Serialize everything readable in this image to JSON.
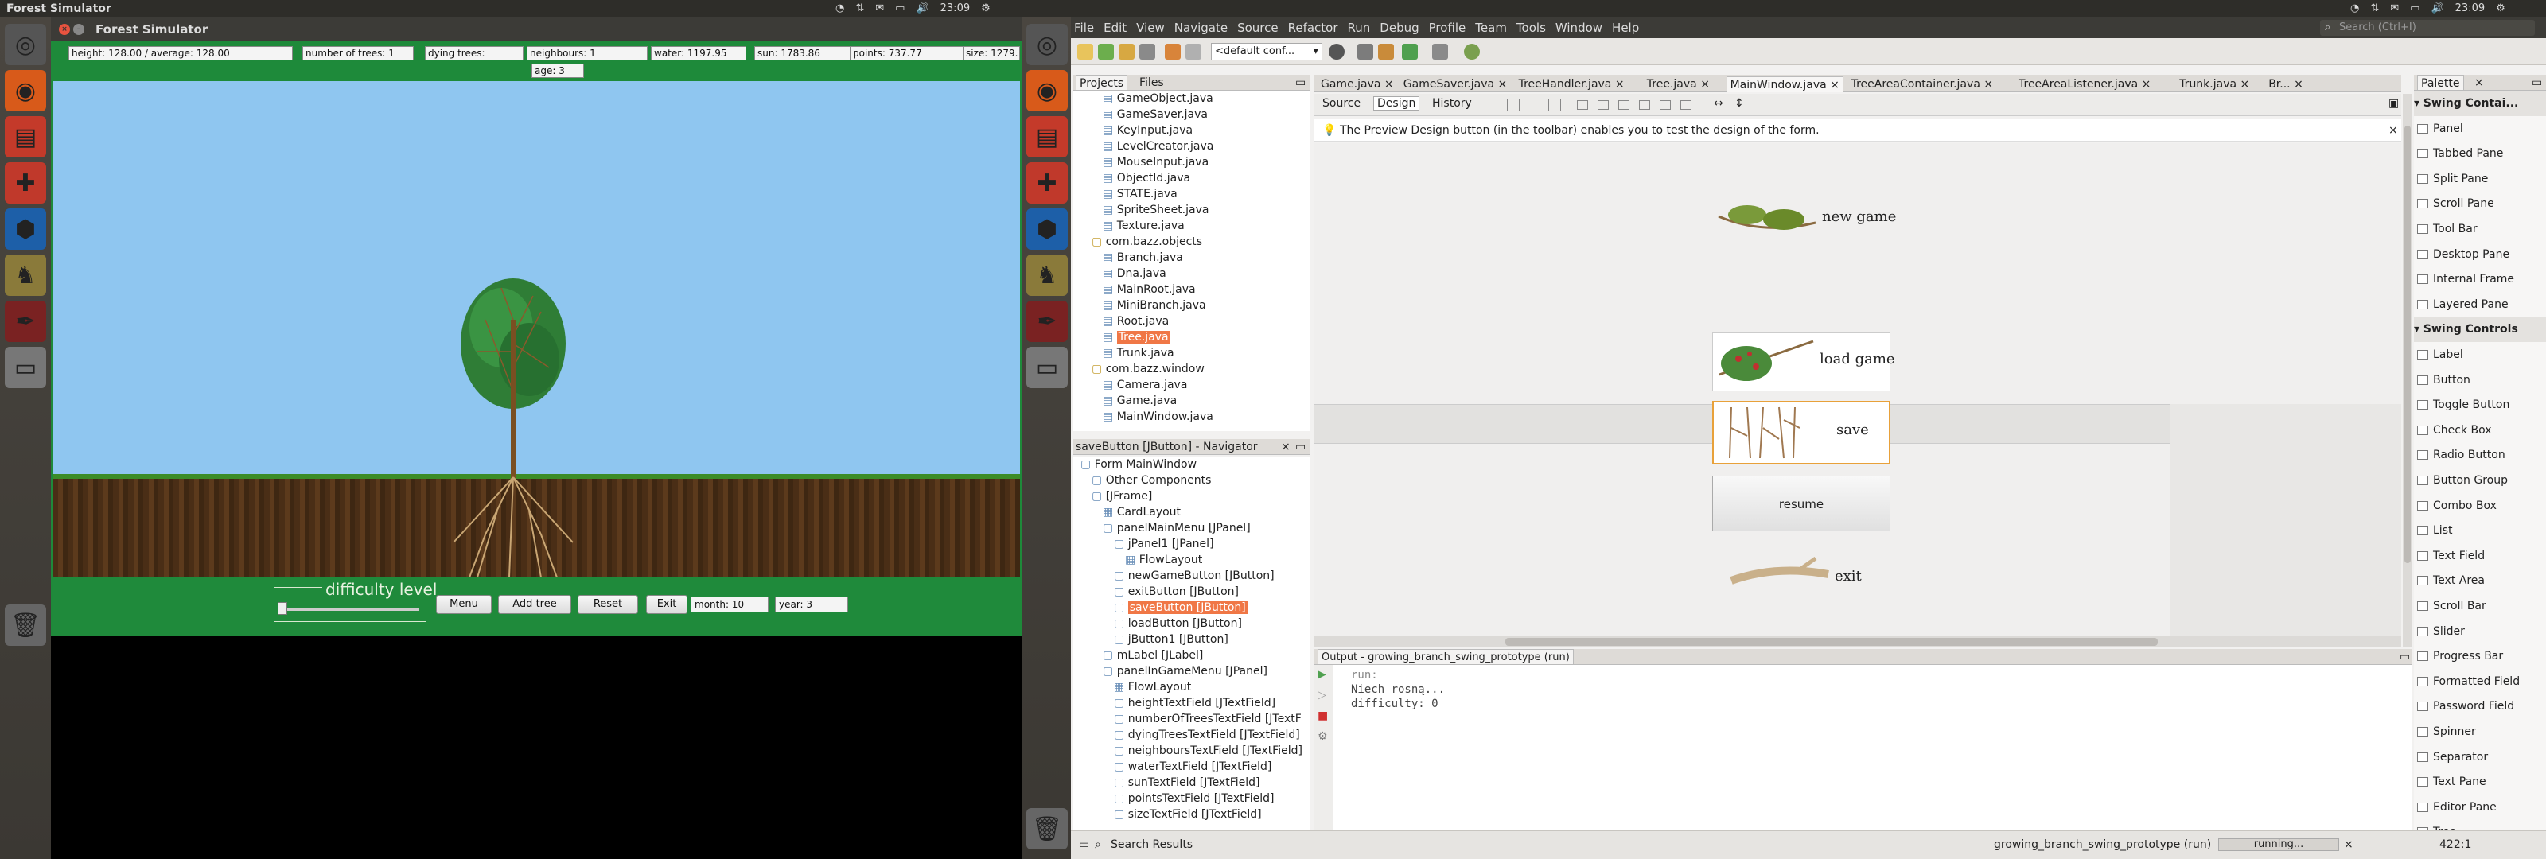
{
  "left_topbar": {
    "title": "Forest Simulator",
    "time": "23:09"
  },
  "right_topbar": {
    "time": "23:09"
  },
  "forest": {
    "window_title": "Forest Simulator",
    "stats": {
      "height": "height: 128.00 / average: 128.00",
      "trees": "number of trees: 1",
      "dying": "dying trees:",
      "neighbours": "neighbours: 1",
      "water": "water: 1197.95",
      "sun": "sun: 1783.86",
      "points": "points: 737.77",
      "size": "size: 1279.",
      "age": "age: 3"
    },
    "difficulty_label": "difficulty level",
    "difficulty_value": 0.0,
    "buttons": {
      "menu": "Menu",
      "add_tree": "Add tree",
      "reset": "Reset",
      "exit": "Exit"
    },
    "month": "month: 10",
    "year": "year: 3"
  },
  "ide": {
    "menu": [
      "File",
      "Edit",
      "View",
      "Navigate",
      "Source",
      "Refactor",
      "Run",
      "Debug",
      "Profile",
      "Team",
      "Tools",
      "Window",
      "Help"
    ],
    "search_placeholder": "Search (Ctrl+I)",
    "config": "<default conf...",
    "projects_tab": "Projects",
    "files_tab": "Files",
    "project_items": [
      {
        "label": "GameObject.java",
        "indent": 2
      },
      {
        "label": "GameSaver.java",
        "indent": 2
      },
      {
        "label": "KeyInput.java",
        "indent": 2
      },
      {
        "label": "LevelCreator.java",
        "indent": 2
      },
      {
        "label": "MouseInput.java",
        "indent": 2
      },
      {
        "label": "ObjectId.java",
        "indent": 2
      },
      {
        "label": "STATE.java",
        "indent": 2
      },
      {
        "label": "SpriteSheet.java",
        "indent": 2
      },
      {
        "label": "Texture.java",
        "indent": 2
      },
      {
        "label": "com.bazz.objects",
        "indent": 1
      },
      {
        "label": "Branch.java",
        "indent": 2
      },
      {
        "label": "Dna.java",
        "indent": 2
      },
      {
        "label": "MainRoot.java",
        "indent": 2
      },
      {
        "label": "MiniBranch.java",
        "indent": 2
      },
      {
        "label": "Root.java",
        "indent": 2
      },
      {
        "label": "Tree.java",
        "indent": 2,
        "selected": true
      },
      {
        "label": "Trunk.java",
        "indent": 2
      },
      {
        "label": "com.bazz.window",
        "indent": 1
      },
      {
        "label": "Camera.java",
        "indent": 2
      },
      {
        "label": "Game.java",
        "indent": 2
      },
      {
        "label": "MainWindow.java",
        "indent": 2
      }
    ],
    "navigator_title": "saveButton [JButton] - Navigator",
    "navigator_items": [
      {
        "label": "Form MainWindow",
        "indent": 0
      },
      {
        "label": "Other Components",
        "indent": 1
      },
      {
        "label": "[JFrame]",
        "indent": 1
      },
      {
        "label": "CardLayout",
        "indent": 2
      },
      {
        "label": "panelMainMenu [JPanel]",
        "indent": 2
      },
      {
        "label": "jPanel1 [JPanel]",
        "indent": 3
      },
      {
        "label": "FlowLayout",
        "indent": 4
      },
      {
        "label": "newGameButton [JButton]",
        "indent": 3
      },
      {
        "label": "exitButton [JButton]",
        "indent": 3
      },
      {
        "label": "saveButton [JButton]",
        "indent": 3,
        "selected": true
      },
      {
        "label": "loadButton [JButton]",
        "indent": 3
      },
      {
        "label": "jButton1 [JButton]",
        "indent": 3
      },
      {
        "label": "mLabel [JLabel]",
        "indent": 2
      },
      {
        "label": "panelInGameMenu [JPanel]",
        "indent": 2
      },
      {
        "label": "FlowLayout",
        "indent": 3
      },
      {
        "label": "heightTextField [JTextField]",
        "indent": 3
      },
      {
        "label": "numberOfTreesTextField [JTextF",
        "indent": 3
      },
      {
        "label": "dyingTreesTextField [JTextField]",
        "indent": 3
      },
      {
        "label": "neighboursTextField [JTextField]",
        "indent": 3
      },
      {
        "label": "waterTextField [JTextField]",
        "indent": 3
      },
      {
        "label": "sunTextField [JTextField]",
        "indent": 3
      },
      {
        "label": "pointsTextField [JTextField]",
        "indent": 3
      },
      {
        "label": "sizeTextField [JTextField]",
        "indent": 3
      }
    ],
    "editor_tabs": [
      "Game.java",
      "GameSaver.java",
      "TreeHandler.java",
      "Tree.java",
      "MainWindow.java",
      "TreeAreaContainer.java",
      "TreeAreaListener.java",
      "Trunk.java",
      "Br..."
    ],
    "active_tab": "MainWindow.java",
    "view_tabs": {
      "source": "Source",
      "design": "Design",
      "history": "History"
    },
    "info_text": "The Preview Design button (in the toolbar) enables you to test the design of the form.",
    "form_buttons": {
      "new_game": "new game",
      "load_game": "load game",
      "save": "save",
      "resume": "resume",
      "exit": "exit"
    },
    "output_title": "Output - growing_branch_swing_prototype (run)",
    "output_lines": [
      "run:",
      "Niech rosną...",
      "difficulty: 0"
    ],
    "palette_title": "Palette",
    "palette_items": [
      {
        "label": "Swing Contai...",
        "header": true
      },
      {
        "label": "Panel"
      },
      {
        "label": "Tabbed Pane"
      },
      {
        "label": "Split Pane"
      },
      {
        "label": "Scroll Pane"
      },
      {
        "label": "Tool Bar"
      },
      {
        "label": "Desktop Pane"
      },
      {
        "label": "Internal Frame"
      },
      {
        "label": "Layered Pane"
      },
      {
        "label": "Swing Controls",
        "header": true
      },
      {
        "label": "Label"
      },
      {
        "label": "Button"
      },
      {
        "label": "Toggle Button"
      },
      {
        "label": "Check Box"
      },
      {
        "label": "Radio Button"
      },
      {
        "label": "Button Group"
      },
      {
        "label": "Combo Box"
      },
      {
        "label": "List"
      },
      {
        "label": "Text Field"
      },
      {
        "label": "Text Area"
      },
      {
        "label": "Scroll Bar"
      },
      {
        "label": "Slider"
      },
      {
        "label": "Progress Bar"
      },
      {
        "label": "Formatted Field"
      },
      {
        "label": "Password Field"
      },
      {
        "label": "Spinner"
      },
      {
        "label": "Separator"
      },
      {
        "label": "Text Pane"
      },
      {
        "label": "Editor Pane"
      },
      {
        "label": "Tree"
      }
    ],
    "status_search": "Search Results",
    "status_run": "growing_branch_swing_prototype (run)",
    "status_running": "running...",
    "status_pos": "422:1"
  }
}
